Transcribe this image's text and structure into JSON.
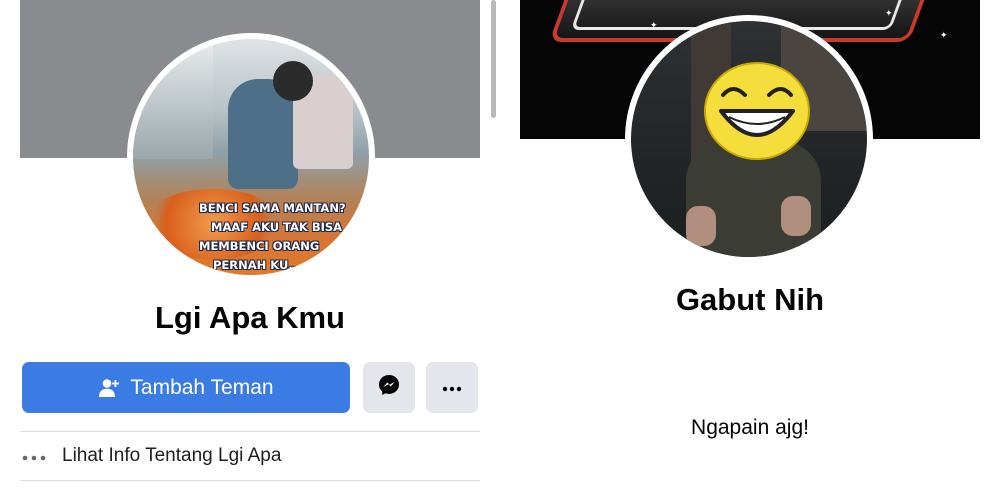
{
  "left_profile": {
    "name": "Lgi Apa Kmu",
    "avatar_caption": [
      "BENCI SAMA MANTAN?",
      "MAAF AKU TAK BISA",
      "MEMBENCI ORANG",
      "PERNAH KU..."
    ],
    "actions": {
      "add_friend_label": "Tambah Teman",
      "add_friend_icon": "add-friend-icon",
      "messenger_icon": "messenger-icon",
      "more_icon": "more-icon"
    },
    "info_link": {
      "icon": "more-dots-icon",
      "label": "Lihat Info Tentang Lgi Apa"
    }
  },
  "right_profile": {
    "name": "Gabut Nih",
    "bio": "Ngapain ajg!",
    "avatar_overlay_icon": "laughing-smiley-icon"
  },
  "colors": {
    "primary_button": "#3b7be4",
    "secondary_button": "#e4e6eb",
    "cover_gray": "#898b8e",
    "text": "#050505"
  }
}
